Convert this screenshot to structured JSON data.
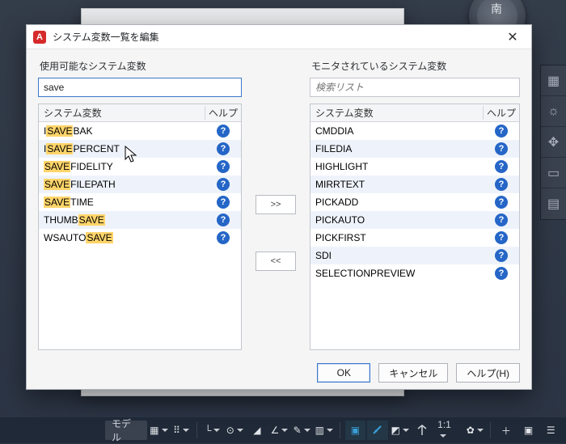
{
  "compass_label": "南",
  "bottom": {
    "mode_label": "モデル",
    "scale_label": "1:1"
  },
  "dialog": {
    "title": "システム変数一覧を編集",
    "close_glyph": "✕"
  },
  "left": {
    "section_label": "使用可能なシステム変数",
    "search_value": "save",
    "col_name": "システム変数",
    "col_help": "ヘルプ",
    "items": [
      {
        "pre": "I",
        "hl": "SAVE",
        "post": "BAK"
      },
      {
        "pre": "I",
        "hl": "SAVE",
        "post": "PERCENT"
      },
      {
        "pre": "",
        "hl": "SAVE",
        "post": "FIDELITY"
      },
      {
        "pre": "",
        "hl": "SAVE",
        "post": "FILEPATH"
      },
      {
        "pre": "",
        "hl": "SAVE",
        "post": "TIME"
      },
      {
        "pre": "THUMB",
        "hl": "SAVE",
        "post": ""
      },
      {
        "pre": "WSAUTO",
        "hl": "SAVE",
        "post": ""
      }
    ]
  },
  "mid": {
    "add": ">>",
    "remove": "<<"
  },
  "right": {
    "section_label": "モニタされているシステム変数",
    "search_placeholder": "検索リスト",
    "col_name": "システム変数",
    "col_help": "ヘルプ",
    "items": [
      "CMDDIA",
      "FILEDIA",
      "HIGHLIGHT",
      "MIRRTEXT",
      "PICKADD",
      "PICKAUTO",
      "PICKFIRST",
      "SDI",
      "SELECTIONPREVIEW"
    ]
  },
  "buttons": {
    "ok": "OK",
    "cancel": "キャンセル",
    "help": "ヘルプ(H)"
  }
}
